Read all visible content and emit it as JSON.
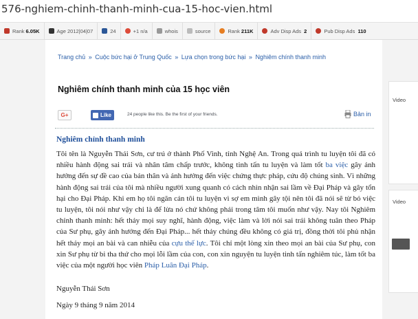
{
  "url_text": "576-nghiem-chinh-thanh-minh-cua-15-hoc-vien.html",
  "seobar": {
    "rank_label": "Rank",
    "rank_value": "6.05K",
    "age_label": "Age",
    "age_value": "2012|04|07",
    "pages_value": "24",
    "plus_value": "+1",
    "plus_na": "n/a",
    "whois": "whois",
    "source": "source",
    "rank2_label": "Rank",
    "rank2_value": "211K",
    "adv_label": "Adv Disp Ads",
    "adv_value": "2",
    "pub_label": "Pub Disp Ads",
    "pub_value": "110",
    "colors": {
      "rank": "#c0392b",
      "age": "#333333",
      "plus": "#dd4b39",
      "rank2": "#e67e22"
    }
  },
  "breadcrumb": {
    "items": [
      "Trang chủ",
      "Cuộc bức hại ở Trung Quốc",
      "Lựa chọn trong bức hại",
      "Nghiêm chính thanh minh"
    ],
    "separator": "»"
  },
  "title": "Nghiêm chính thanh minh của 15 học viên",
  "share": {
    "gplus": "G+",
    "fb_like": "Like",
    "fb_text": "24 people like this. Be the first of your friends.",
    "print": "Bản in"
  },
  "article": {
    "heading": "Nghiêm chỉnh thanh minh",
    "p1": "Tôi tên là Nguyễn Thái Sơn, cư trú ở thành Phố Vinh, tỉnh Nghệ An. Trong quá trình tu luyện tôi đã có nhiều hành động sai trái và nhân tâm chấp trước, không tinh tấn tu luyện và làm tốt",
    "link1": "ba việc",
    "p2": "gây ảnh hưởng đến sự đề cao của bản thân và ảnh hưởng đến việc chứng thực pháp, cứu độ chúng sinh. Vì những hành động sai trái của tôi mà nhiều người xung quanh có cách nhìn nhận sai lầm về Đại Pháp và gây tổn hại cho Đại Pháp. Khi em họ tôi ngăn cản tôi tu luyện vì sợ em mình gây tội nên tôi đã nói sẽ từ bỏ việc tu luyện, tôi nói như vậy chỉ là để lừa nó chứ không phải trong tâm tôi muốn như vậy. Nay tôi Nghiêm chỉnh thanh minh: hết thảy mọi suy nghĩ, hành động, việc làm và lời nói sai trái không tuân theo Pháp của Sư phụ, gây ảnh hưởng đến Đại Pháp... hết thảy chúng đều không có giá trị, đồng thời tôi phủ nhận hết thảy mọi an bài và can nhiễu của",
    "link2": "cựu thế lực",
    "p3": ". Tôi chỉ một lòng xin theo mọi an bài của Sư phụ, con xin Sư phụ từ bi tha thứ cho mọi lỗi lầm của con, con xin nguyện tu luyện tinh tấn nghiêm túc, làm tốt ba việc của một người học viên",
    "link3": "Pháp Luân Đại Pháp",
    "p4": ".",
    "signature": "Nguyễn Thái Sơn",
    "date": "Ngày 9 tháng 9 năm 2014"
  },
  "sidebar": {
    "label1": "Video",
    "label2": "Video"
  }
}
